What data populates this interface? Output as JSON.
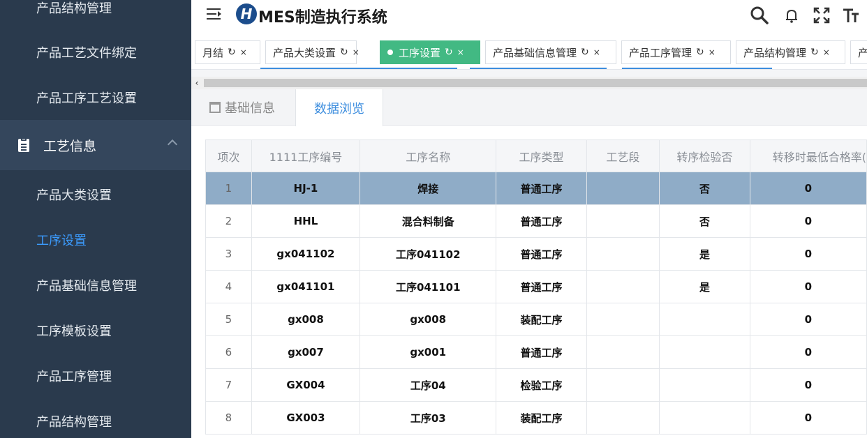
{
  "sidebar": {
    "items_top": [
      {
        "label": "产品结构管理"
      },
      {
        "label": "产品工艺文件绑定"
      },
      {
        "label": "产品工序工艺设置"
      }
    ],
    "section": {
      "label": "工艺信息",
      "icon": "clipboard-icon"
    },
    "items_bottom": [
      {
        "label": "产品大类设置",
        "active": false
      },
      {
        "label": "工序设置",
        "active": true
      },
      {
        "label": "产品基础信息管理",
        "active": false
      },
      {
        "label": "工序模板设置",
        "active": false
      },
      {
        "label": "产品工序管理",
        "active": false
      },
      {
        "label": "产品结构管理",
        "active": false
      }
    ]
  },
  "header": {
    "logo_letter": "H",
    "title": "MES制造执行系统"
  },
  "tabs": [
    {
      "label": "月结",
      "refresh": "↻",
      "close": "×"
    },
    {
      "label": "产品大类设置",
      "refresh": "↻",
      "close": "×"
    },
    {
      "label": "工序设置",
      "refresh": "↻",
      "close": "×",
      "active": true
    },
    {
      "label": "产品基础信息管理",
      "refresh": "↻",
      "close": "×"
    },
    {
      "label": "产品工序管理",
      "refresh": "↻",
      "close": "×"
    },
    {
      "label": "产品结构管理",
      "refresh": "↻",
      "close": "×"
    },
    {
      "label": "产"
    }
  ],
  "scroll": {
    "left_arrow": "‹"
  },
  "content_tabs": [
    {
      "label": "基础信息"
    },
    {
      "label": "数据浏览",
      "active": true
    }
  ],
  "table": {
    "columns": [
      "项次",
      "1111工序编号",
      "工序名称",
      "工序类型",
      "工艺段",
      "转序检验否",
      "转移时最低合格率("
    ],
    "rows": [
      [
        "1",
        "HJ-1",
        "焊接",
        "普通工序",
        "",
        "否",
        "0"
      ],
      [
        "2",
        "HHL",
        "混合料制备",
        "普通工序",
        "",
        "否",
        "0"
      ],
      [
        "3",
        "gx041102",
        "工序041102",
        "普通工序",
        "",
        "是",
        "0"
      ],
      [
        "4",
        "gx041101",
        "工序041101",
        "普通工序",
        "",
        "是",
        "0"
      ],
      [
        "5",
        "gx008",
        "gx008",
        "装配工序",
        "",
        "",
        "0"
      ],
      [
        "6",
        "gx007",
        "gx001",
        "普通工序",
        "",
        "",
        "0"
      ],
      [
        "7",
        "GX004",
        "工序04",
        "检验工序",
        "",
        "",
        "0"
      ],
      [
        "8",
        "GX003",
        "工序03",
        "装配工序",
        "",
        "",
        "0"
      ]
    ],
    "selected_row": 0
  },
  "colors": {
    "sidebar_bg": "#2a3a4d",
    "active_menu": "#3c9cff",
    "active_tab": "#42b983",
    "selected_row": "#8facc7"
  }
}
